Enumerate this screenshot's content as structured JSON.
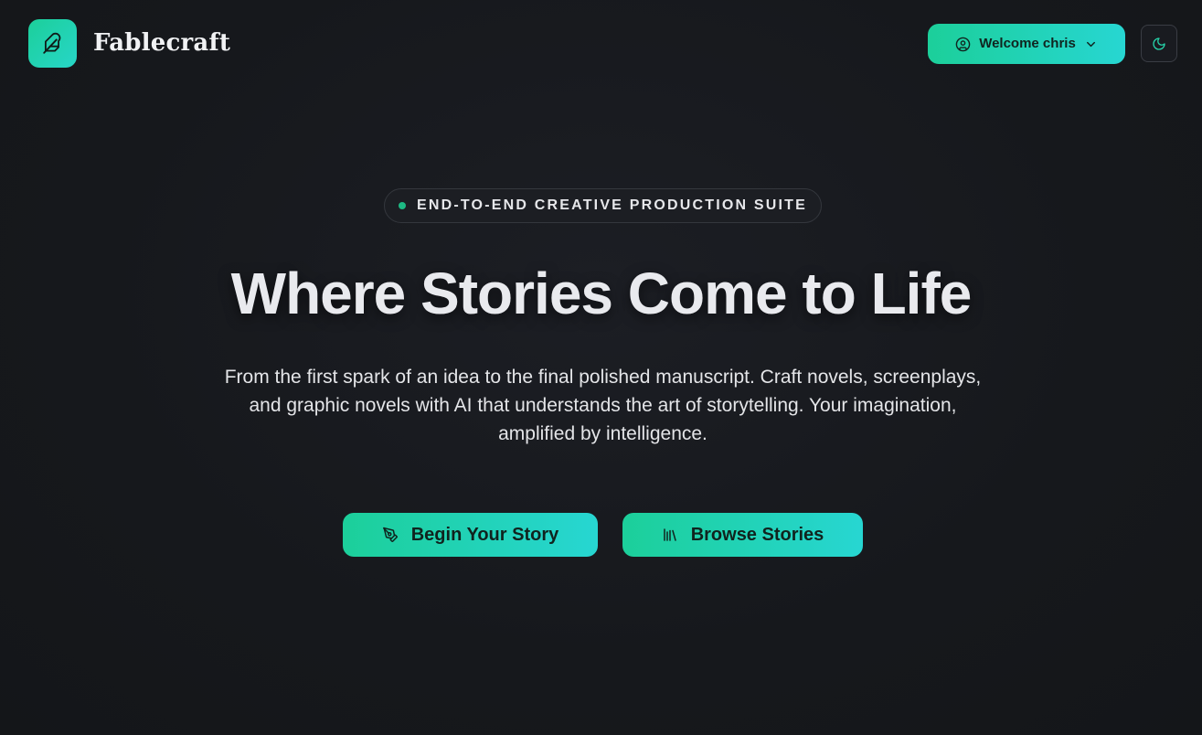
{
  "header": {
    "brand": "Fablecraft",
    "logo_icon": "feather-icon",
    "user_menu_label": "Welcome chris",
    "user_icon": "user-circle-icon",
    "user_menu_caret": "chevron-down-icon",
    "theme_toggle_icon": "moon-icon"
  },
  "hero": {
    "badge": "END-TO-END CREATIVE PRODUCTION SUITE",
    "title": "Where Stories Come to Life",
    "subtitle": "From the first spark of an idea to the final polished manuscript. Craft novels, screenplays, and graphic novels with AI that understands the art of storytelling. Your imagination, amplified by intelligence.",
    "primary_cta": "Begin Your Story",
    "primary_cta_icon": "pen-tool-icon",
    "secondary_cta": "Browse Stories",
    "secondary_cta_icon": "library-icon"
  },
  "colors": {
    "background": "#16181c",
    "accent_start": "#1ccf9a",
    "accent_end": "#27d6d2",
    "badge_dot": "#1db983",
    "text": "#e9eaee"
  }
}
